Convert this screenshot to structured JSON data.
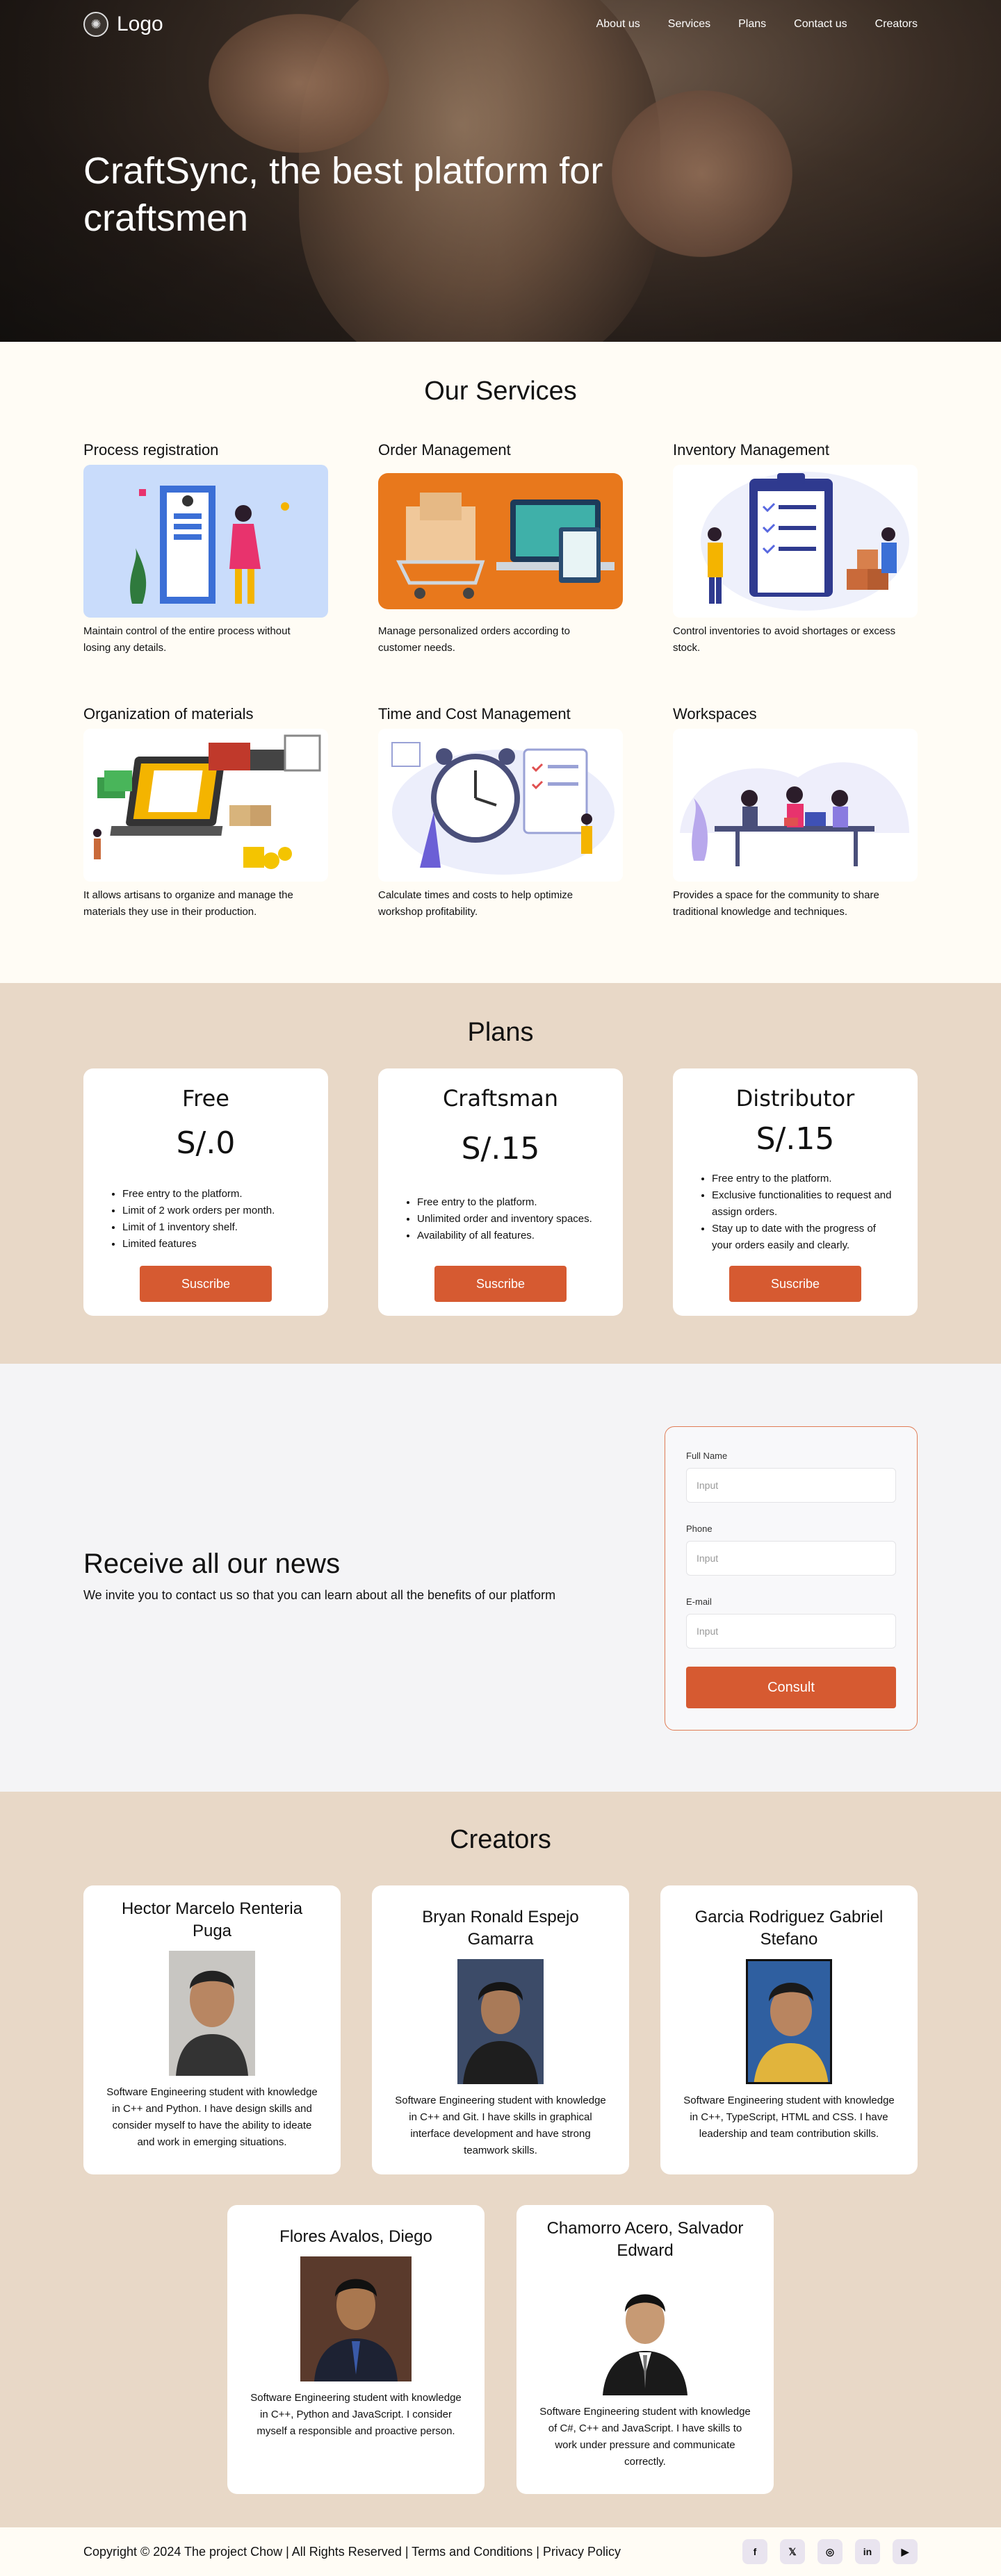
{
  "nav": {
    "logo": "Logo",
    "links": [
      "About us",
      "Services",
      "Plans",
      "Contact us",
      "Creators"
    ]
  },
  "hero": {
    "title": "CraftSync, the best platform for craftsmen"
  },
  "services": {
    "title": "Our Services",
    "items": [
      {
        "title": "Process registration",
        "desc": "Maintain control of the entire process without losing any details."
      },
      {
        "title": "Order Management",
        "desc": "Manage personalized orders according to customer needs."
      },
      {
        "title": "Inventory Management",
        "desc": "Control inventories to avoid shortages or excess stock."
      },
      {
        "title": "Organization of materials",
        "desc": "It allows artisans to organize and manage the materials they use in their production."
      },
      {
        "title": "Time and Cost Management",
        "desc": "Calculate times and costs to help optimize workshop profitability."
      },
      {
        "title": "Workspaces",
        "desc": "Provides a space for the community to share traditional knowledge and techniques."
      }
    ]
  },
  "plans": {
    "title": "Plans",
    "button_label": "Suscribe",
    "items": [
      {
        "name": "Free",
        "price": "S/.0",
        "features": [
          "Free entry to the platform.",
          "Limit of 2 work orders per month.",
          "Limit of 1 inventory shelf.",
          "Limited features"
        ]
      },
      {
        "name": "Craftsman",
        "price": "S/.15",
        "features": [
          "Free entry to the platform.",
          "Unlimited order and inventory spaces.",
          "Availability of all features."
        ]
      },
      {
        "name": "Distributor",
        "price": "S/.15",
        "features": [
          "Free entry to the platform.",
          "Exclusive functionalities to request and assign orders.",
          "Stay up to date with the progress of your orders easily and clearly."
        ]
      }
    ]
  },
  "news": {
    "title": "Receive all our news",
    "subtitle": "We invite you to contact us so that you can learn about all the benefits of our platform",
    "form": {
      "fullname_label": "Full Name",
      "phone_label": "Phone",
      "email_label": "E-mail",
      "placeholder": "Input",
      "submit_label": "Consult"
    }
  },
  "creators": {
    "title": "Creators",
    "items": [
      {
        "name": "Hector Marcelo Renteria Puga",
        "bio": "Software Engineering student with knowledge in C++ and Python. I have design skills and consider myself to have the ability to ideate and work in emerging situations."
      },
      {
        "name": "Bryan Ronald Espejo Gamarra",
        "bio": "Software Engineering student with knowledge in C++ and Git. I have skills in graphical interface development and have strong teamwork skills."
      },
      {
        "name": "Garcia Rodriguez Gabriel Stefano",
        "bio": "Software Engineering student with knowledge in C++, TypeScript, HTML and CSS. I have leadership and team contribution skills."
      },
      {
        "name": "Flores Avalos, Diego",
        "bio": "Software Engineering student with knowledge in C++, Python and JavaScript. I consider myself a responsible and proactive person."
      },
      {
        "name": "Chamorro Acero, Salvador Edward",
        "bio": "Software Engineering student with knowledge of C#, C++ and JavaScript. I have skills to work under pressure and communicate correctly."
      }
    ]
  },
  "footer": {
    "copyright": "Copyright © 2024 The project Chow | All Rights Reserved | Terms and Conditions | Privacy Policy",
    "socials": [
      {
        "icon": "facebook-icon",
        "glyph": "f"
      },
      {
        "icon": "twitter-icon",
        "glyph": "𝕏"
      },
      {
        "icon": "instagram-icon",
        "glyph": "◎"
      },
      {
        "icon": "linkedin-icon",
        "glyph": "in"
      },
      {
        "icon": "youtube-icon",
        "glyph": "▶"
      }
    ]
  },
  "colors": {
    "accent": "#d65a31",
    "beige": "#e8d8c7",
    "cream": "#fffcf5"
  }
}
